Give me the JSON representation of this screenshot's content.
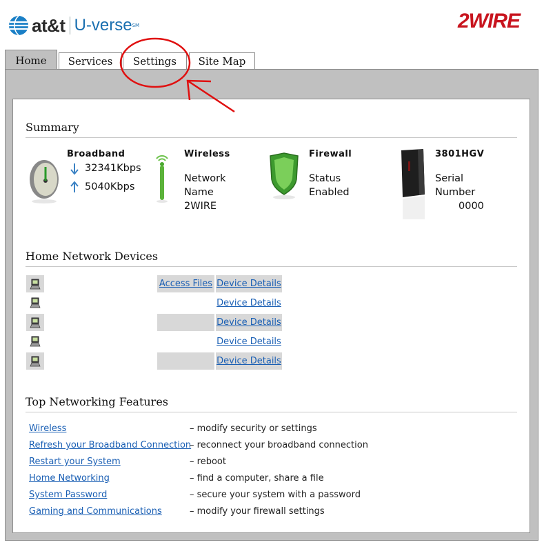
{
  "header": {
    "att_text": "at&t",
    "uverse_text": "U-verse",
    "uverse_sm": "SM",
    "brand_2wire": "2WIRE"
  },
  "tabs": [
    {
      "label": "Home",
      "active": true
    },
    {
      "label": "Services",
      "active": false
    },
    {
      "label": "Settings",
      "active": false
    },
    {
      "label": "Site Map",
      "active": false
    }
  ],
  "summary": {
    "title": "Summary",
    "broadband": {
      "label": "Broadband",
      "down": "32341Kbps",
      "up": "5040Kbps"
    },
    "wireless": {
      "label": "Wireless",
      "line1": "Network",
      "line2": "Name",
      "line3": "2WIRE"
    },
    "firewall": {
      "label": "Firewall",
      "line1": "Status",
      "line2": "Enabled"
    },
    "device": {
      "label": "3801HGV",
      "line1": "Serial",
      "line2": "Number",
      "line3": "0000"
    }
  },
  "home_network": {
    "title": "Home Network Devices",
    "access_files": "Access Files",
    "device_details": "Device Details"
  },
  "features": {
    "title": "Top Networking Features",
    "items": [
      {
        "link": "Wireless",
        "desc": "– modify security or settings"
      },
      {
        "link": "Refresh your Broadband Connection",
        "desc": "– reconnect your broadband connection"
      },
      {
        "link": "Restart your System",
        "desc": "– reboot"
      },
      {
        "link": "Home Networking",
        "desc": "– find a computer, share a file"
      },
      {
        "link": "System Password",
        "desc": "– secure your system with a password"
      },
      {
        "link": "Gaming and Communications",
        "desc": "– modify your firewall settings"
      }
    ]
  },
  "colors": {
    "annotation": "#e01010",
    "brand_red": "#c8141e",
    "link": "#1a5fb4"
  }
}
